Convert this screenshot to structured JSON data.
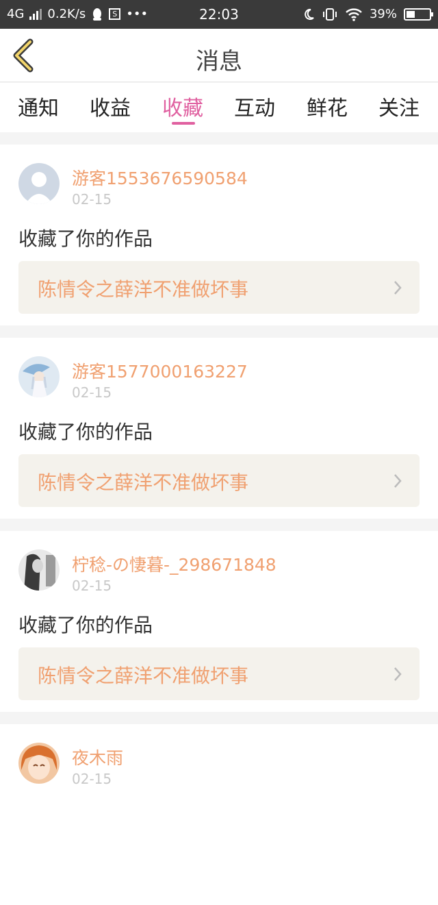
{
  "status_bar": {
    "network": "4G",
    "speed": "0.2K/s",
    "time": "22:03",
    "battery": "39%",
    "battery_level": 0.39
  },
  "header": {
    "title": "消息"
  },
  "tabs": [
    {
      "label": "通知"
    },
    {
      "label": "收益"
    },
    {
      "label": "收藏",
      "active": true
    },
    {
      "label": "互动"
    },
    {
      "label": "鲜花"
    },
    {
      "label": "关注"
    }
  ],
  "items": [
    {
      "username": "游客1553676590584",
      "date": "02-15",
      "action": "收藏了你的作品",
      "work": "陈情令之薛洋不准做坏事",
      "avatar": "default-avatar"
    },
    {
      "username": "游客1577000163227",
      "date": "02-15",
      "action": "收藏了你的作品",
      "work": "陈情令之薛洋不准做坏事",
      "avatar": "anime-girl-umbrella-avatar"
    },
    {
      "username": "柠稔-の悽暮-_298671848",
      "date": "02-15",
      "action": "收藏了你的作品",
      "work": "陈情令之薛洋不准做坏事",
      "avatar": "monochrome-photo-avatar"
    },
    {
      "username": "夜木雨",
      "date": "02-15",
      "action": "",
      "work": "",
      "avatar": "anime-orange-hair-avatar"
    }
  ],
  "colors": {
    "accent": "#e060a0",
    "username": "#f0a070",
    "date": "#c8c8c8",
    "work_bg": "#f4f2ec",
    "status_bg": "#3a3a3a"
  }
}
